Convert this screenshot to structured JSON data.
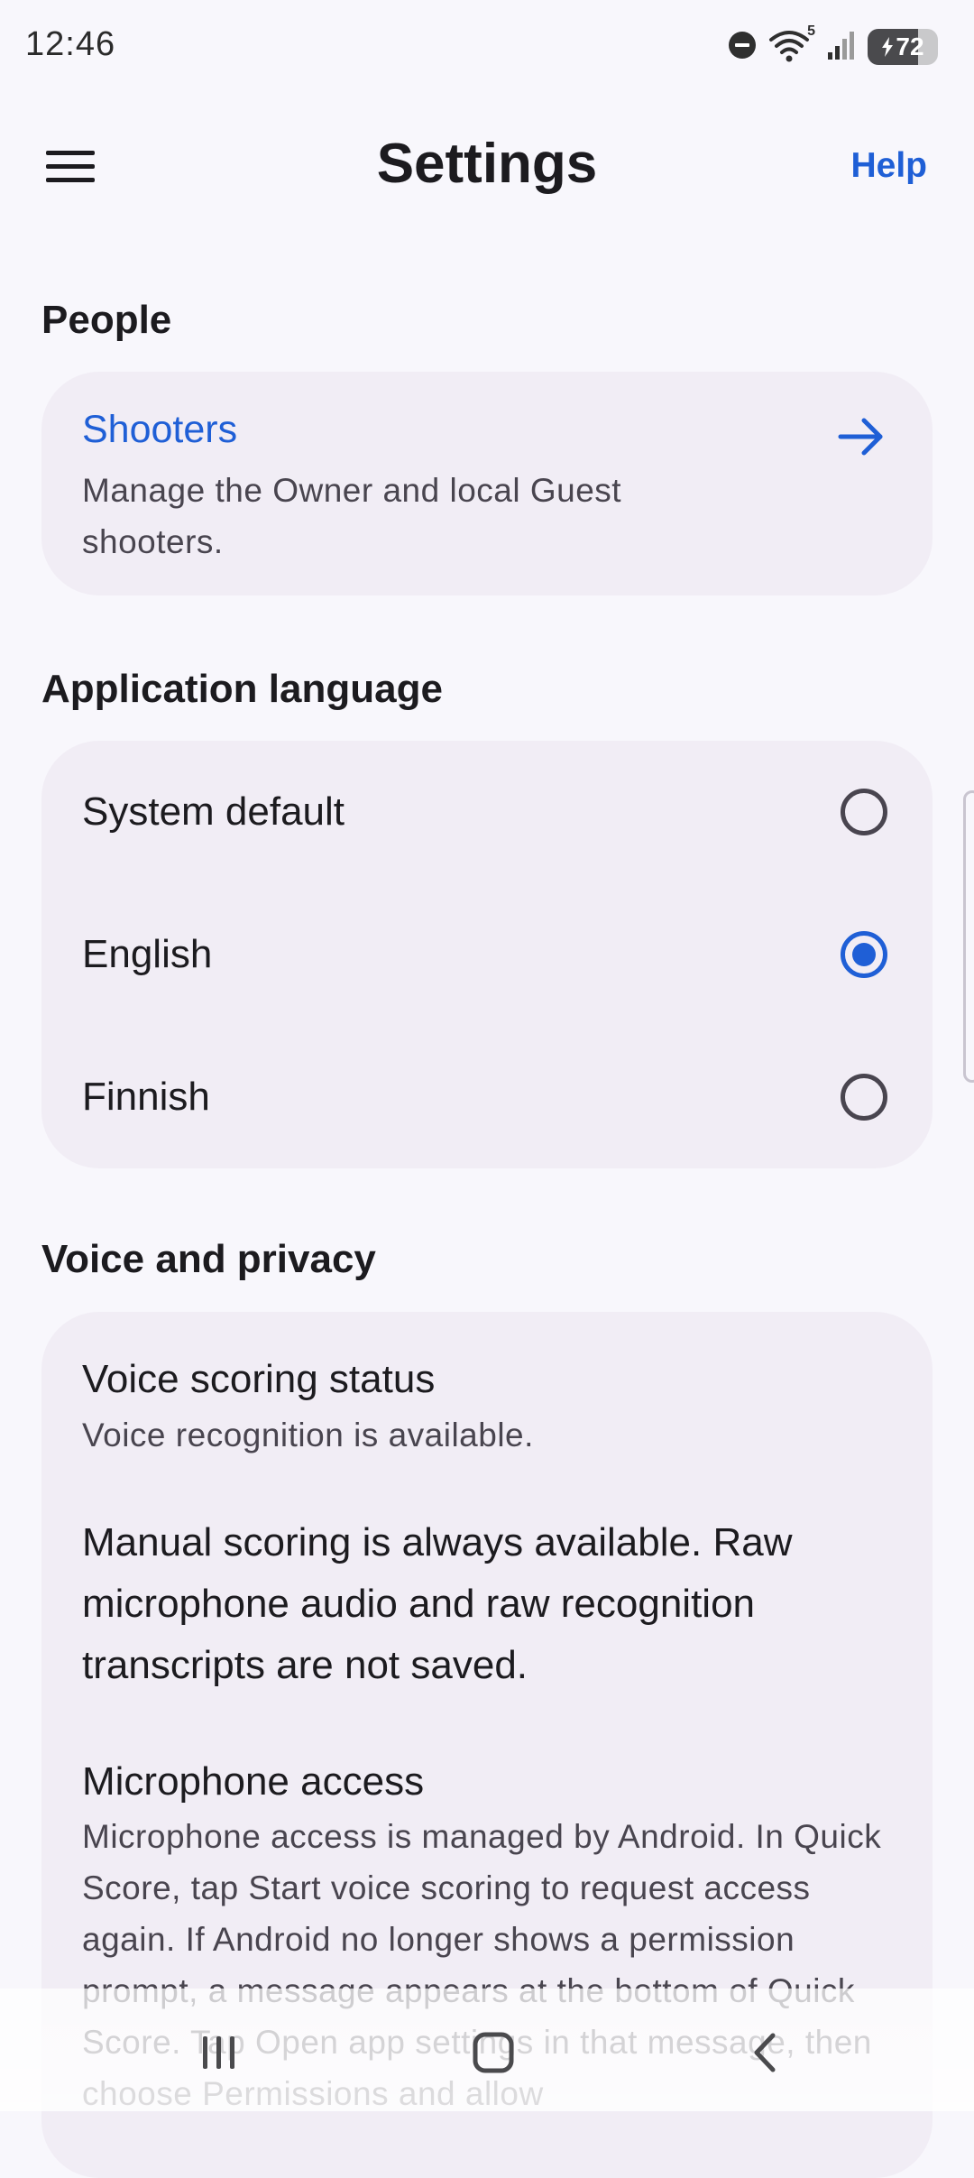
{
  "status_bar": {
    "time": "12:46",
    "battery_level": "72",
    "wifi_badge": "5",
    "icons": [
      "dnd-icon",
      "wifi-icon",
      "signal-icon",
      "battery-icon"
    ]
  },
  "app_bar": {
    "title": "Settings",
    "help_label": "Help",
    "menu_icon": "menu-icon"
  },
  "people": {
    "heading": "People",
    "shooters_title": "Shooters",
    "shooters_desc": "Manage the Owner and local Guest shooters.",
    "arrow_icon": "arrow-right-icon"
  },
  "language": {
    "heading": "Application language",
    "options": [
      {
        "label": "System default",
        "selected": false
      },
      {
        "label": "English",
        "selected": true
      },
      {
        "label": "Finnish",
        "selected": false
      }
    ]
  },
  "voice": {
    "heading": "Voice and privacy",
    "status_title": "Voice scoring status",
    "status_desc": "Voice recognition is available.",
    "manual_note": "Manual scoring is always available. Raw microphone audio and raw recognition transcripts are not saved.",
    "mic_title": "Microphone access",
    "mic_desc": "Microphone access is managed by Android. In Quick Score, tap Start voice scoring to request access again. If Android no longer shows a permission prompt, a message appears at the bottom of Quick Score. Tap Open app settings in that message, then choose Permissions and allow"
  },
  "nav_bar": {
    "icons": [
      "recents-icon",
      "home-icon",
      "back-icon"
    ]
  },
  "colors": {
    "accent": "#1f5fd6",
    "background": "#f8f7fc",
    "card": "#f1edf5",
    "text": "#1c1b1f",
    "secondary_text": "#49454f"
  }
}
